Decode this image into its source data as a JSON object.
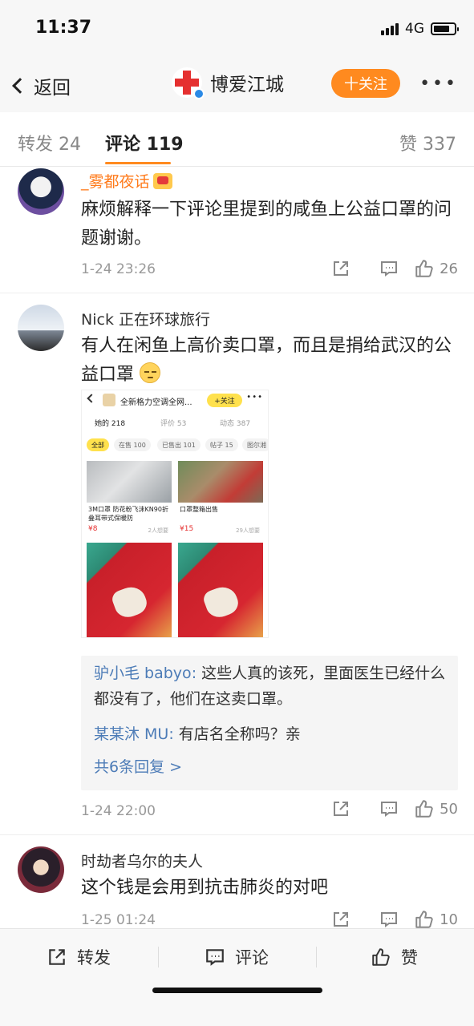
{
  "status": {
    "time": "11:37",
    "network": "4G",
    "battery_level": 0.8
  },
  "nav": {
    "back_label": "返回",
    "account_name": "博爱江城",
    "follow_label": "十关注",
    "more": "•••"
  },
  "tabs": [
    {
      "label": "转发 24"
    },
    {
      "label": "评论 119"
    },
    {
      "label": "赞 337"
    }
  ],
  "comments": [
    {
      "user": "_雾都夜话",
      "text": "麻烦解释一下评论里提到的咸鱼上公益口罩的问题谢谢。",
      "time": "1-24 23:26",
      "likes": "26"
    },
    {
      "user": "Nick 正在环球旅行",
      "text": "有人在闲鱼上高价卖口罩，而且是捐给武汉的公益口罩",
      "time": "1-24 22:00",
      "likes": "50",
      "screenshot": {
        "title": "全新格力空调全网...",
        "follow": "+关注",
        "more": "•••",
        "tabs": [
          "她的 218",
          "评价 53",
          "动态 387"
        ],
        "chips": [
          "全部",
          "在售 100",
          "已售出 101",
          "帖子 15",
          "图尔湘"
        ],
        "products": [
          {
            "title": "3M口罩 防花粉飞沫KN90折叠耳带式保暖防",
            "price": "¥8",
            "wants": "2人想要"
          },
          {
            "title": "口罩整箱出售",
            "price": "¥15",
            "wants": "29人想要"
          }
        ]
      },
      "replies": [
        {
          "user": "驴小毛 babyo",
          "text": "这些人真的该死，里面医生已经什么都没有了，他们在这卖口罩。"
        },
        {
          "user": "某某沐 MU",
          "text": "有店名全称吗？亲"
        }
      ],
      "more_replies": "共6条回复 >"
    },
    {
      "user": "时劫者乌尔的夫人",
      "text": "这个钱是会用到抗击肺炎的对吧",
      "time": "1-25 01:24",
      "likes": "10"
    }
  ],
  "bottom": {
    "repost": "转发",
    "comment": "评论",
    "like": "赞"
  },
  "colors": {
    "accent": "#ff8a1f",
    "link": "#4d7cb7",
    "brand_red": "#e53030"
  }
}
